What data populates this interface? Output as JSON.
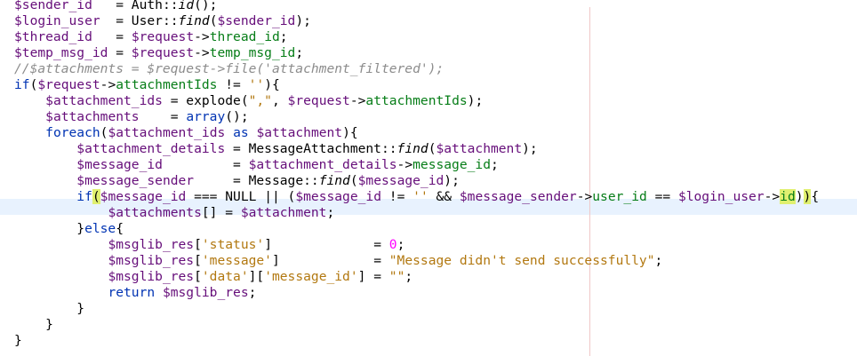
{
  "code": {
    "lines": [
      [
        {
          "t": "$sender_id",
          "c": "var"
        },
        {
          "t": "   = Auth::"
        },
        {
          "t": "id",
          "c": "fn"
        },
        {
          "t": "();"
        }
      ],
      [
        {
          "t": "$login_user",
          "c": "var"
        },
        {
          "t": "  = User::"
        },
        {
          "t": "find",
          "c": "fn"
        },
        {
          "t": "("
        },
        {
          "t": "$sender_id",
          "c": "var"
        },
        {
          "t": ");"
        }
      ],
      [
        {
          "t": "$thread_id",
          "c": "var"
        },
        {
          "t": "   = "
        },
        {
          "t": "$request",
          "c": "var"
        },
        {
          "t": "->"
        },
        {
          "t": "thread_id",
          "c": "prop"
        },
        {
          "t": ";"
        }
      ],
      [
        {
          "t": "$temp_msg_id",
          "c": "var"
        },
        {
          "t": " = "
        },
        {
          "t": "$request",
          "c": "var"
        },
        {
          "t": "->"
        },
        {
          "t": "temp_msg_id",
          "c": "prop"
        },
        {
          "t": ";"
        }
      ],
      [
        {
          "t": "//$attachments = $request->file('attachment_filtered');",
          "c": "com"
        }
      ],
      [
        {
          "t": "if",
          "c": "kw"
        },
        {
          "t": "("
        },
        {
          "t": "$request",
          "c": "var"
        },
        {
          "t": "->"
        },
        {
          "t": "attachmentIds",
          "c": "prop"
        },
        {
          "t": " != "
        },
        {
          "t": "''",
          "c": "str"
        },
        {
          "t": "){"
        }
      ],
      [
        {
          "t": "    "
        },
        {
          "t": "$attachment_ids",
          "c": "var"
        },
        {
          "t": " = explode("
        },
        {
          "t": "\",\"",
          "c": "str"
        },
        {
          "t": ", "
        },
        {
          "t": "$request",
          "c": "var"
        },
        {
          "t": "->"
        },
        {
          "t": "attachmentIds",
          "c": "prop"
        },
        {
          "t": ");"
        }
      ],
      [
        {
          "t": "    "
        },
        {
          "t": "$attachments",
          "c": "var"
        },
        {
          "t": "    = "
        },
        {
          "t": "array",
          "c": "kw"
        },
        {
          "t": "();"
        }
      ],
      [
        {
          "t": "    "
        },
        {
          "t": "foreach",
          "c": "kw"
        },
        {
          "t": "("
        },
        {
          "t": "$attachment_ids",
          "c": "var"
        },
        {
          "t": " "
        },
        {
          "t": "as",
          "c": "kw"
        },
        {
          "t": " "
        },
        {
          "t": "$attachment",
          "c": "var"
        },
        {
          "t": "){"
        }
      ],
      [
        {
          "t": "        "
        },
        {
          "t": "$attachment_details",
          "c": "var"
        },
        {
          "t": " = MessageAttachment::"
        },
        {
          "t": "find",
          "c": "fn"
        },
        {
          "t": "("
        },
        {
          "t": "$attachment",
          "c": "var"
        },
        {
          "t": ");"
        }
      ],
      [
        {
          "t": "        "
        },
        {
          "t": "$message_id",
          "c": "var"
        },
        {
          "t": "         = "
        },
        {
          "t": "$attachment_details",
          "c": "var"
        },
        {
          "t": "->"
        },
        {
          "t": "message_id",
          "c": "prop"
        },
        {
          "t": ";"
        }
      ],
      [
        {
          "t": "        "
        },
        {
          "t": "$message_sender",
          "c": "var"
        },
        {
          "t": "     = Message::"
        },
        {
          "t": "find",
          "c": "fn"
        },
        {
          "t": "("
        },
        {
          "t": "$message_id",
          "c": "var"
        },
        {
          "t": ");"
        }
      ],
      [
        {
          "t": "        "
        },
        {
          "t": "if",
          "c": "kw"
        },
        {
          "t": "(",
          "c": "brace"
        },
        {
          "t": "$message_id",
          "c": "var"
        },
        {
          "t": " === NULL || ("
        },
        {
          "t": "$message_id",
          "c": "var"
        },
        {
          "t": " != "
        },
        {
          "t": "''",
          "c": "str"
        },
        {
          "t": " && "
        },
        {
          "t": "$message_sender",
          "c": "var"
        },
        {
          "t": "->"
        },
        {
          "t": "user_id",
          "c": "prop"
        },
        {
          "t": " == "
        },
        {
          "t": "$login_user",
          "c": "var"
        },
        {
          "t": "->"
        },
        {
          "t": "id",
          "c": "idhl"
        },
        {
          "t": ")"
        },
        {
          "t": ")",
          "c": "brace"
        },
        {
          "t": "{"
        }
      ],
      [
        {
          "t": "            "
        },
        {
          "t": "$attachments",
          "c": "var"
        },
        {
          "t": "[] = "
        },
        {
          "t": "$attachment",
          "c": "var"
        },
        {
          "t": ";"
        }
      ],
      [
        {
          "t": "        }"
        },
        {
          "t": "else",
          "c": "kw"
        },
        {
          "t": "{"
        }
      ],
      [
        {
          "t": "            "
        },
        {
          "t": "$msglib_res",
          "c": "var"
        },
        {
          "t": "["
        },
        {
          "t": "'status'",
          "c": "str"
        },
        {
          "t": "]             = "
        },
        {
          "t": "0",
          "c": "num"
        },
        {
          "t": ";"
        }
      ],
      [
        {
          "t": "            "
        },
        {
          "t": "$msglib_res",
          "c": "var"
        },
        {
          "t": "["
        },
        {
          "t": "'message'",
          "c": "str"
        },
        {
          "t": "]            = "
        },
        {
          "t": "\"Message didn't send successfully\"",
          "c": "str"
        },
        {
          "t": ";"
        }
      ],
      [
        {
          "t": "            "
        },
        {
          "t": "$msglib_res",
          "c": "var"
        },
        {
          "t": "["
        },
        {
          "t": "'data'",
          "c": "str"
        },
        {
          "t": "]["
        },
        {
          "t": "'message_id'",
          "c": "str"
        },
        {
          "t": "] = "
        },
        {
          "t": "\"\"",
          "c": "str"
        },
        {
          "t": ";"
        }
      ],
      [
        {
          "t": "            "
        },
        {
          "t": "return",
          "c": "kw"
        },
        {
          "t": " "
        },
        {
          "t": "$msglib_res",
          "c": "var"
        },
        {
          "t": ";"
        }
      ],
      [
        {
          "t": "        }"
        }
      ],
      [
        {
          "t": "    }"
        }
      ],
      [
        {
          "t": "}"
        }
      ]
    ]
  }
}
